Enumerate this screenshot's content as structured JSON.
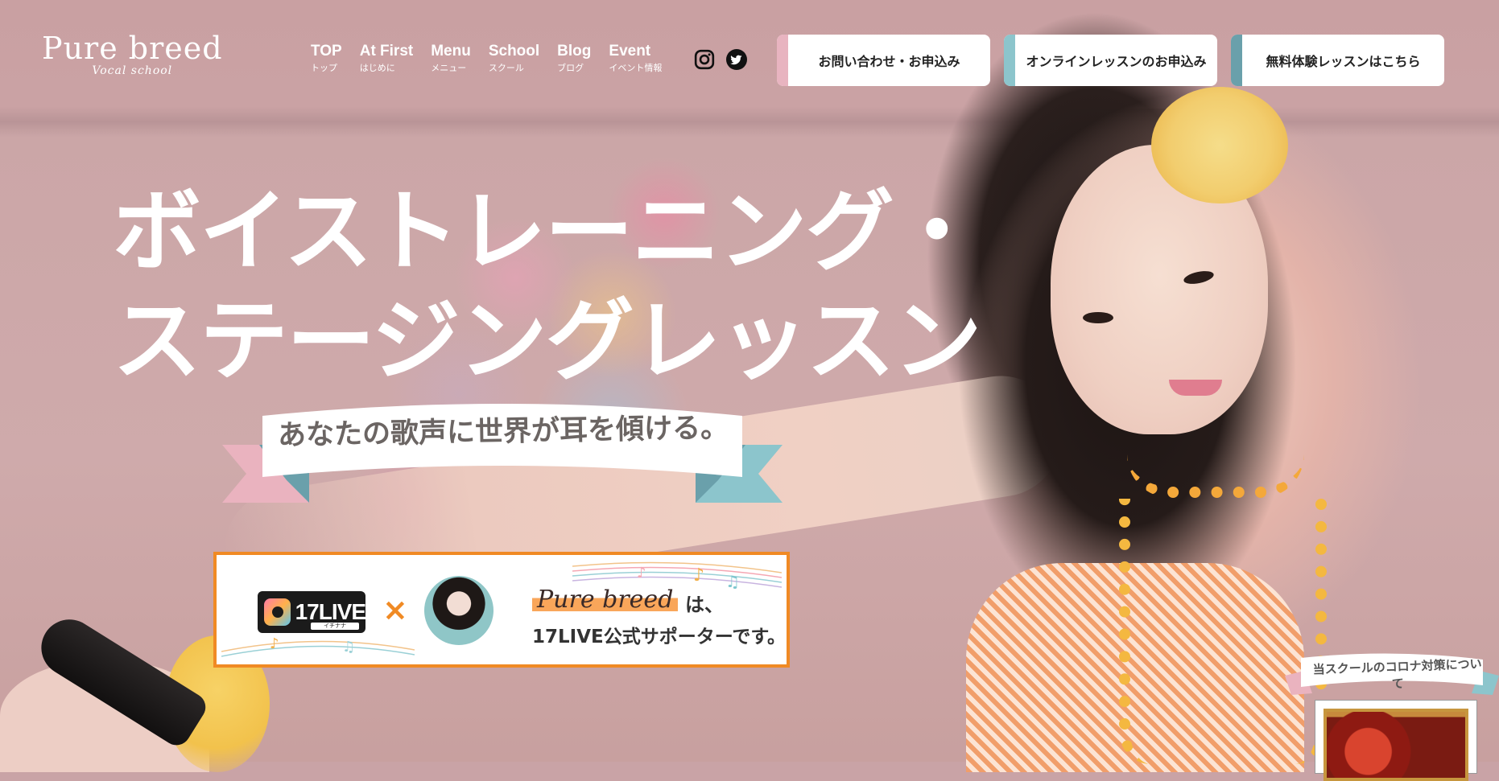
{
  "brand": {
    "name": "Pure breed",
    "tagline": "Vocal school"
  },
  "nav": [
    {
      "en": "TOP",
      "jp": "トップ"
    },
    {
      "en": "At First",
      "jp": "はじめに"
    },
    {
      "en": "Menu",
      "jp": "メニュー"
    },
    {
      "en": "School",
      "jp": "スクール"
    },
    {
      "en": "Blog",
      "jp": "ブログ"
    },
    {
      "en": "Event",
      "jp": "イベント情報"
    }
  ],
  "social": {
    "instagram": "instagram-icon",
    "twitter": "twitter-icon"
  },
  "cta": {
    "contact": {
      "label": "お問い合わせ・お申込み",
      "accent": "#e8b4c0"
    },
    "online": {
      "label": "オンラインレッスンのお申込み",
      "accent": "#8cc5cc"
    },
    "trial": {
      "label": "無料体験レッスンはこちら",
      "accent": "#6aa0ab"
    }
  },
  "hero": {
    "headline_line1": "ボイストレーニング・",
    "headline_line2": "ステージングレッスン",
    "ribbon_text": "あなたの歌声に世界が耳を傾ける。"
  },
  "banner": {
    "logo_text": "17LIVE",
    "logo_small": "イチナナ",
    "times": "×",
    "brand": "Pure breed",
    "wa": "は、",
    "line2": "17LIVE公式サポーターです。"
  },
  "corona": {
    "label": "当スクールのコロナ対策について"
  },
  "colors": {
    "banner_border": "#f08a24",
    "ribbon_pink": "#e8b4c0",
    "ribbon_teal": "#6aa0ab"
  }
}
